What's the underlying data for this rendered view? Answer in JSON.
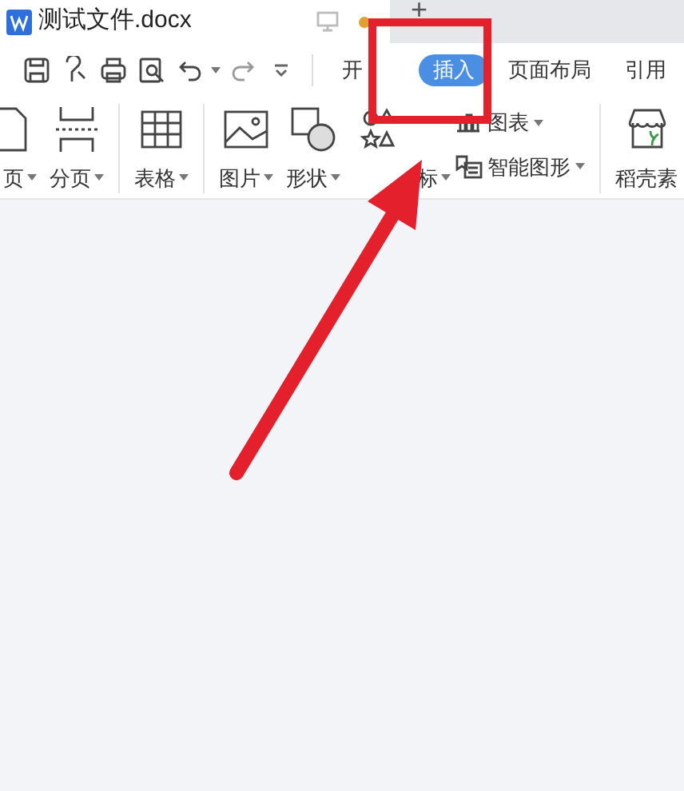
{
  "window": {
    "title": "测试文件.docx",
    "new_tab_symbol": "+"
  },
  "tabs": [
    {
      "label": "开",
      "selected": false
    },
    {
      "label": "插入",
      "selected": true
    },
    {
      "label": "页面布局",
      "selected": false
    },
    {
      "label": "引用",
      "selected": false
    }
  ],
  "ribbon": [
    {
      "kind": "large",
      "label": "页",
      "caret": true
    },
    {
      "kind": "large",
      "label": "分页",
      "caret": true
    },
    {
      "kind": "divider"
    },
    {
      "kind": "large",
      "label": "表格",
      "caret": true
    },
    {
      "kind": "divider"
    },
    {
      "kind": "large",
      "label": "图片",
      "caret": true
    },
    {
      "kind": "large",
      "label": "形状",
      "caret": true
    },
    {
      "kind": "large",
      "label": "标",
      "caret": true
    },
    {
      "kind": "small",
      "items": [
        {
          "label": "图表"
        },
        {
          "label": "智能图形"
        }
      ]
    },
    {
      "kind": "divider"
    },
    {
      "kind": "large",
      "label": "稻壳素",
      "caret": false
    }
  ]
}
